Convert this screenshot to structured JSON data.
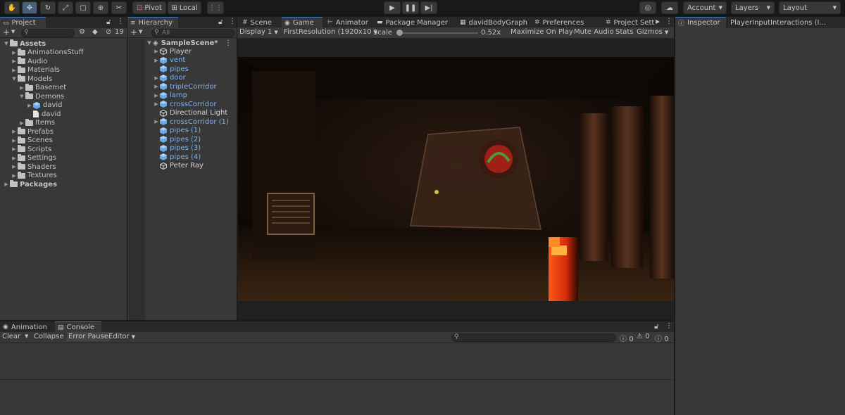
{
  "toolbar": {
    "tools": [
      "hand-icon",
      "move-icon",
      "rotate-icon",
      "scale-icon",
      "rect-icon",
      "transform-icon",
      "custom-tool-icon"
    ],
    "pivot_label": "Pivot",
    "local_label": "Local",
    "account_label": "Account",
    "layers_label": "Layers",
    "layout_label": "Layout"
  },
  "project": {
    "tab_label": "Project",
    "hidden_count": "19",
    "items": [
      {
        "label": "Assets",
        "depth": 0,
        "expanded": true,
        "type": "folder",
        "bold": true
      },
      {
        "label": "AnimationsStuff",
        "depth": 1,
        "expanded": false,
        "type": "folder"
      },
      {
        "label": "Audio",
        "depth": 1,
        "expanded": false,
        "type": "folder"
      },
      {
        "label": "Materials",
        "depth": 1,
        "expanded": false,
        "type": "folder"
      },
      {
        "label": "Models",
        "depth": 1,
        "expanded": true,
        "type": "folder"
      },
      {
        "label": "Basemet",
        "depth": 2,
        "expanded": false,
        "type": "folder"
      },
      {
        "label": "Demons",
        "depth": 2,
        "expanded": true,
        "type": "folder"
      },
      {
        "label": "david",
        "depth": 3,
        "expanded": false,
        "type": "prefab"
      },
      {
        "label": "david",
        "depth": 3,
        "expanded": null,
        "type": "file"
      },
      {
        "label": "Items",
        "depth": 2,
        "expanded": false,
        "type": "folder"
      },
      {
        "label": "Prefabs",
        "depth": 1,
        "expanded": false,
        "type": "folder"
      },
      {
        "label": "Scenes",
        "depth": 1,
        "expanded": false,
        "type": "folder"
      },
      {
        "label": "Scripts",
        "depth": 1,
        "expanded": false,
        "type": "folder"
      },
      {
        "label": "Settings",
        "depth": 1,
        "expanded": false,
        "type": "folder"
      },
      {
        "label": "Shaders",
        "depth": 1,
        "expanded": false,
        "type": "folder"
      },
      {
        "label": "Textures",
        "depth": 1,
        "expanded": false,
        "type": "folder"
      },
      {
        "label": "Packages",
        "depth": 0,
        "expanded": false,
        "type": "folder",
        "bold": true
      }
    ]
  },
  "hierarchy": {
    "tab_label": "Hierarchy",
    "search_placeholder": "All",
    "scene_name": "SampleScene*",
    "items": [
      {
        "label": "Player",
        "arrow": true,
        "color": "white",
        "icon": "gameobject"
      },
      {
        "label": "vent",
        "arrow": true,
        "color": "blue",
        "icon": "prefab"
      },
      {
        "label": "pipes",
        "arrow": false,
        "color": "blue",
        "icon": "prefab"
      },
      {
        "label": "door",
        "arrow": true,
        "color": "blue",
        "icon": "prefab"
      },
      {
        "label": "tripleCorridor",
        "arrow": true,
        "color": "blue",
        "icon": "prefab"
      },
      {
        "label": "lamp",
        "arrow": true,
        "color": "blue",
        "icon": "prefab"
      },
      {
        "label": "crossCorridor",
        "arrow": true,
        "color": "blue",
        "icon": "prefab"
      },
      {
        "label": "Directional Light",
        "arrow": false,
        "color": "white",
        "icon": "gameobject"
      },
      {
        "label": "crossCorridor (1)",
        "arrow": true,
        "color": "blue",
        "icon": "prefab"
      },
      {
        "label": "pipes (1)",
        "arrow": false,
        "color": "blue",
        "icon": "prefab"
      },
      {
        "label": "pipes (2)",
        "arrow": false,
        "color": "blue",
        "icon": "prefab"
      },
      {
        "label": "pipes (3)",
        "arrow": false,
        "color": "blue",
        "icon": "prefab"
      },
      {
        "label": "pipes (4)",
        "arrow": false,
        "color": "blue",
        "icon": "prefab"
      },
      {
        "label": "Peter Ray",
        "arrow": false,
        "color": "white",
        "icon": "gameobject"
      }
    ]
  },
  "center_tabs": [
    {
      "label": "Scene",
      "icon": "#",
      "active": false
    },
    {
      "label": "Game",
      "icon": "◉",
      "active": true
    },
    {
      "label": "Animator",
      "icon": "⊢",
      "active": false
    },
    {
      "label": "Package Manager",
      "icon": "▬",
      "active": false
    },
    {
      "label": "davidBodyGraph",
      "icon": "▦",
      "active": false
    },
    {
      "label": "Preferences",
      "icon": "✲",
      "active": false
    },
    {
      "label": "Project Settings",
      "icon": "✲",
      "active": false
    }
  ],
  "game_bar": {
    "display": "Display 1",
    "resolution": "FirstResolution (1920x10",
    "scale_label": "Scale",
    "scale_value": "0.52x",
    "maximize": "Maximize On Play",
    "mute": "Mute Audio",
    "stats": "Stats",
    "gizmos": "Gizmos"
  },
  "inspector": {
    "tab_label": "Inspector",
    "second_tab": "PlayerInputInteractions (I..."
  },
  "bottom": {
    "tabs": [
      {
        "label": "Animation",
        "active": false
      },
      {
        "label": "Console",
        "active": true
      }
    ],
    "clear": "Clear",
    "collapse": "Collapse",
    "error_pause": "Error Pause",
    "editor": "Editor",
    "info_count": "0",
    "warn_count": "0",
    "error_count": "0"
  },
  "colors": {
    "accent": "#3a79bb",
    "prefab_text": "#7fb2ef",
    "panel": "#383838",
    "background": "#191919"
  }
}
